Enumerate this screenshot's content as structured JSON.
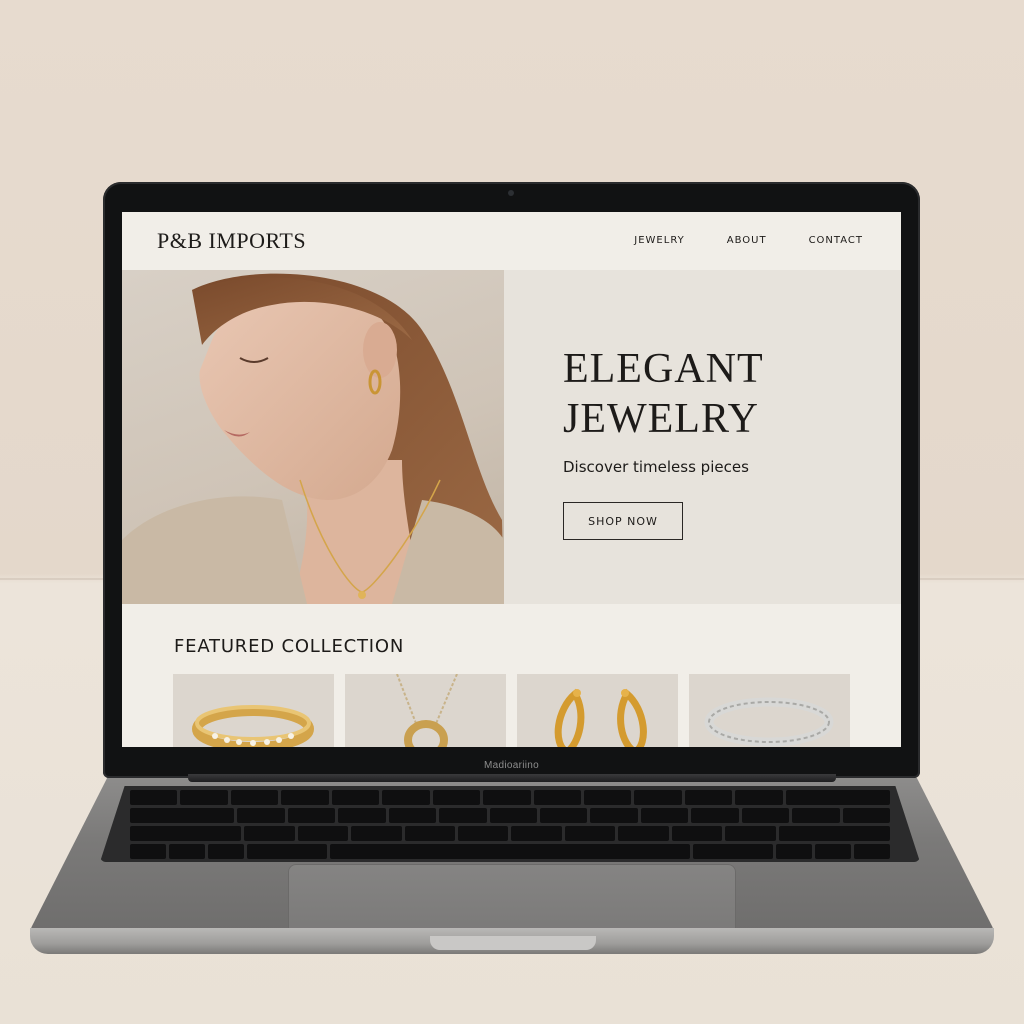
{
  "site": {
    "logo": "P&B IMPORTS",
    "nav": [
      {
        "label": "JEWELRY"
      },
      {
        "label": "ABOUT"
      },
      {
        "label": "CONTACT"
      }
    ]
  },
  "hero": {
    "title": "ELEGANT\nJEWELRY",
    "subtitle": "Discover timeless pieces",
    "cta_label": "SHOP NOW"
  },
  "featured": {
    "title": "FEATURED COLLECTION",
    "products": [
      {
        "icon": "gold-ring-icon"
      },
      {
        "icon": "gold-necklace-icon"
      },
      {
        "icon": "gold-earrings-icon"
      },
      {
        "icon": "silver-bracelet-icon"
      }
    ]
  },
  "laptop": {
    "brand_label": "Madioariino"
  },
  "colors": {
    "background": "#e7dbcf",
    "site_background": "#efece6",
    "hero_panel": "#e7e3dc",
    "gold": "#d4a54a",
    "text": "#1d1b19"
  }
}
